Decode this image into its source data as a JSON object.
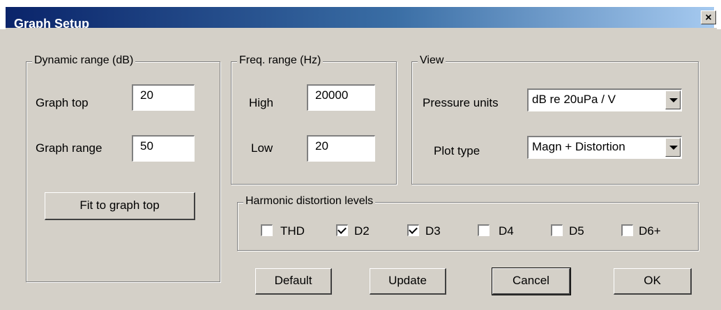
{
  "window": {
    "title": "Graph Setup",
    "close_glyph": "✕"
  },
  "dynamic_range": {
    "legend": "Dynamic range (dB)",
    "graph_top_label": "Graph top",
    "graph_top_value": "20",
    "graph_range_label": "Graph range",
    "graph_range_value": "50",
    "fit_button": "Fit to graph top"
  },
  "freq_range": {
    "legend": "Freq. range (Hz)",
    "high_label": "High",
    "high_value": "20000",
    "low_label": "Low",
    "low_value": "20"
  },
  "view": {
    "legend": "View",
    "pressure_units_label": "Pressure units",
    "pressure_units_value": "dB re 20uPa / V",
    "plot_type_label": "Plot type",
    "plot_type_value": "Magn + Distortion"
  },
  "harmonic": {
    "legend": "Harmonic distortion  levels",
    "items": [
      {
        "label": "THD",
        "checked": false
      },
      {
        "label": "D2",
        "checked": true
      },
      {
        "label": "D3",
        "checked": true
      },
      {
        "label": "D4",
        "checked": false
      },
      {
        "label": "D5",
        "checked": false
      },
      {
        "label": "D6+",
        "checked": false
      }
    ]
  },
  "buttons": {
    "default": "Default",
    "update": "Update",
    "cancel": "Cancel",
    "ok": "OK"
  }
}
